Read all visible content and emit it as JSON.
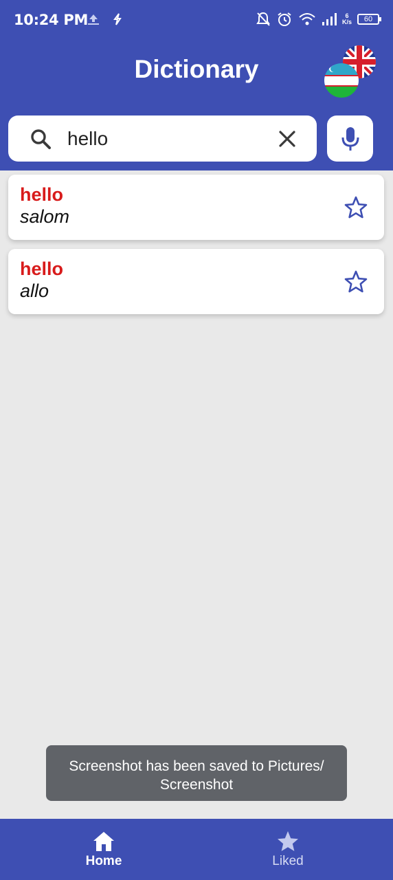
{
  "status_bar": {
    "time": "10:24 PM",
    "net_speed_value": "6",
    "net_speed_unit": "K/s",
    "battery": "60",
    "icons": [
      "upload-icon",
      "sync-icon",
      "notifications-off-icon",
      "alarm-icon",
      "wifi-icon",
      "signal-icon",
      "battery-icon"
    ]
  },
  "app_bar": {
    "title": "Dictionary",
    "language_switch": {
      "front_flag": "uzbekistan-flag-icon",
      "back_flag": "uk-flag-icon"
    }
  },
  "search": {
    "value": "hello",
    "icon": "search-icon",
    "clear_icon": "close-icon",
    "voice_icon": "mic-icon"
  },
  "results": [
    {
      "word": "hello",
      "translation": "salom",
      "liked": false
    },
    {
      "word": "hello",
      "translation": "allo",
      "liked": false
    }
  ],
  "toast": {
    "line1": "Screenshot has been saved to  Pictures/",
    "line2": "Screenshot"
  },
  "bottom_nav": {
    "home": {
      "label": "Home",
      "icon": "home-icon",
      "active": true
    },
    "liked": {
      "label": "Liked",
      "icon": "star-icon",
      "active": false
    }
  },
  "colors": {
    "primary": "#3e4fb3",
    "word": "#d81b1b",
    "background": "#e9e9e9",
    "toast": "#606368"
  }
}
